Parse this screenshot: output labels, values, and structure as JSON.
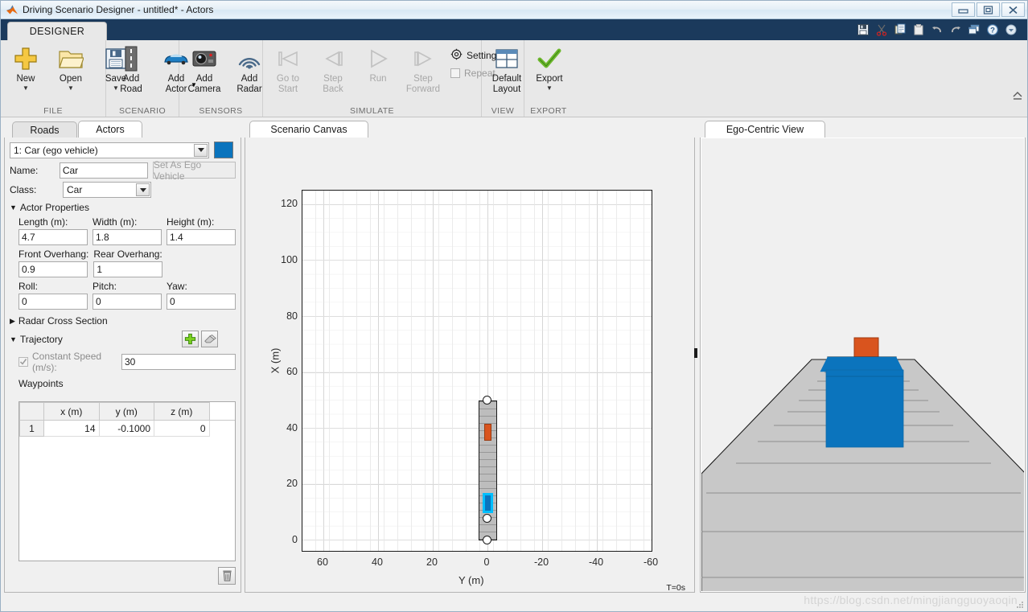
{
  "window": {
    "title": "Driving Scenario Designer - untitled* - Actors",
    "app_icon": "matlab-icon",
    "minimize_label": "Minimize",
    "restore_label": "Restore",
    "close_label": "Close"
  },
  "ribbon": {
    "tab_label": "DESIGNER",
    "quick_access": [
      {
        "name": "save-icon",
        "label": "Save"
      },
      {
        "name": "cut-icon",
        "label": "Cut"
      },
      {
        "name": "copy-icon",
        "label": "Copy"
      },
      {
        "name": "paste-icon",
        "label": "Paste"
      },
      {
        "name": "undo-icon",
        "label": "Undo"
      },
      {
        "name": "redo-icon",
        "label": "Redo"
      },
      {
        "name": "layout-icon",
        "label": "Layout"
      },
      {
        "name": "help-icon",
        "label": "Help"
      },
      {
        "name": "chevron-down-icon",
        "label": "More"
      }
    ],
    "groups": [
      {
        "footer": "FILE",
        "buttons": [
          {
            "label": "New",
            "icon": "new-icon",
            "caret": true,
            "disabled": false
          },
          {
            "label": "Open",
            "icon": "open-folder-icon",
            "caret": true,
            "disabled": false
          },
          {
            "label": "Save",
            "icon": "save-disk-icon",
            "caret": true,
            "disabled": false
          }
        ]
      },
      {
        "footer": "SCENARIO",
        "buttons": [
          {
            "label": "Add\nRoad",
            "icon": "add-road-icon",
            "caret": false,
            "disabled": false
          },
          {
            "label": "Add\nActor",
            "icon": "add-actor-icon",
            "caret": true,
            "caret_inline": true,
            "disabled": false
          }
        ]
      },
      {
        "footer": "SENSORS",
        "buttons": [
          {
            "label": "Add\nCamera",
            "icon": "add-camera-icon",
            "caret": false,
            "disabled": false
          },
          {
            "label": "Add\nRadar",
            "icon": "add-radar-icon",
            "caret": false,
            "disabled": false
          }
        ]
      },
      {
        "footer": "SIMULATE",
        "buttons": [
          {
            "label": "Go to\nStart",
            "icon": "go-to-start-icon",
            "caret": false,
            "disabled": true
          },
          {
            "label": "Step\nBack",
            "icon": "step-back-icon",
            "caret": false,
            "disabled": true
          },
          {
            "label": "Run",
            "icon": "run-icon",
            "caret": false,
            "disabled": true
          },
          {
            "label": "Step\nForward",
            "icon": "step-forward-icon",
            "caret": false,
            "disabled": true
          }
        ],
        "settings_label": "Settings",
        "repeat_label": "Repeat",
        "repeat_checked": false
      },
      {
        "footer": "VIEW",
        "buttons": [
          {
            "label": "Default\nLayout",
            "icon": "default-layout-icon",
            "caret": false,
            "disabled": false
          }
        ]
      },
      {
        "footer": "EXPORT",
        "buttons": [
          {
            "label": "Export",
            "icon": "export-check-icon",
            "caret": true,
            "disabled": false
          }
        ]
      }
    ]
  },
  "left_panel": {
    "tabs": [
      {
        "label": "Roads",
        "active": false
      },
      {
        "label": "Actors",
        "active": true
      }
    ],
    "actor_selector": {
      "value": "1: Car (ego vehicle)",
      "color": "#0b74bd"
    },
    "name_label": "Name:",
    "name_value": "Car",
    "set_ego_button": "Set As Ego Vehicle",
    "class_label": "Class:",
    "class_value": "Car",
    "actor_properties": {
      "header": "Actor Properties",
      "expanded": true,
      "fields": [
        {
          "label": "Length (m):",
          "value": "4.7"
        },
        {
          "label": "Width (m):",
          "value": "1.8"
        },
        {
          "label": "Height (m):",
          "value": "1.4"
        },
        {
          "label": "Front Overhang:",
          "value": "0.9"
        },
        {
          "label": "Rear Overhang:",
          "value": "1"
        },
        {
          "label": "Roll:",
          "value": "0"
        },
        {
          "label": "Pitch:",
          "value": "0"
        },
        {
          "label": "Yaw:",
          "value": "0"
        }
      ]
    },
    "radar_cross_section": {
      "header": "Radar Cross Section",
      "expanded": false
    },
    "trajectory": {
      "header": "Trajectory",
      "expanded": true,
      "add_icon": "add-waypoint-icon",
      "erase_icon": "eraser-icon",
      "constant_speed_label": "Constant Speed (m/s):",
      "constant_speed_checked": true,
      "constant_speed_value": "30",
      "waypoints_label": "Waypoints",
      "columns": [
        "",
        "x (m)",
        "y (m)",
        "z (m)"
      ],
      "rows": [
        {
          "index": "1",
          "x": "14",
          "y": "-0.1000",
          "z": "0"
        }
      ]
    },
    "delete_icon": "trash-icon",
    "settings_icon": "gear-icon"
  },
  "canvas_panel": {
    "tab_label": "Scenario Canvas",
    "timestamp": "T=0s"
  },
  "ego_panel": {
    "tab_label": "Ego-Centric View"
  },
  "chart_data": {
    "type": "scatter",
    "title": "Scenario Canvas",
    "xlabel": "Y (m)",
    "ylabel": "X (m)",
    "xticks": [
      "60",
      "40",
      "20",
      "0",
      "-20",
      "-40",
      "-60"
    ],
    "xtick_values": [
      60,
      40,
      20,
      0,
      -20,
      -40,
      -60
    ],
    "yticks": [
      "0",
      "20",
      "40",
      "60",
      "80",
      "100",
      "120"
    ],
    "ytick_values": [
      0,
      20,
      40,
      60,
      80,
      100,
      120
    ],
    "xlim": [
      68,
      -68
    ],
    "ylim": [
      -7,
      128
    ],
    "grid": true,
    "legend": "none",
    "road": {
      "label": "road-segment",
      "y_center": 0,
      "width_m": 7.2,
      "x_start": 0,
      "x_end": 50,
      "color": "#bdbdbd"
    },
    "waypoints": [
      {
        "x": 0,
        "y": 0,
        "marker": "circle"
      },
      {
        "x": 12,
        "y": 0,
        "marker": "circle"
      },
      {
        "x": 50,
        "y": 0,
        "marker": "circle"
      }
    ],
    "actors": [
      {
        "name": "Car (ego vehicle)",
        "x": 14,
        "y": -0.1,
        "color": "#0b74bd",
        "selected": true,
        "highlight": "#00bfff"
      },
      {
        "name": "Other vehicle",
        "x": 40,
        "y": 0,
        "color": "#d9541e",
        "selected": false
      }
    ]
  },
  "ego_view": {
    "road_color": "#c8c8c8",
    "ego_car_color": "#0b74bd",
    "lead_car_color": "#d9541e",
    "sky_color": "#f0f0f0"
  },
  "watermark": "https://blog.csdn.net/mingjiangguoyaoqin"
}
